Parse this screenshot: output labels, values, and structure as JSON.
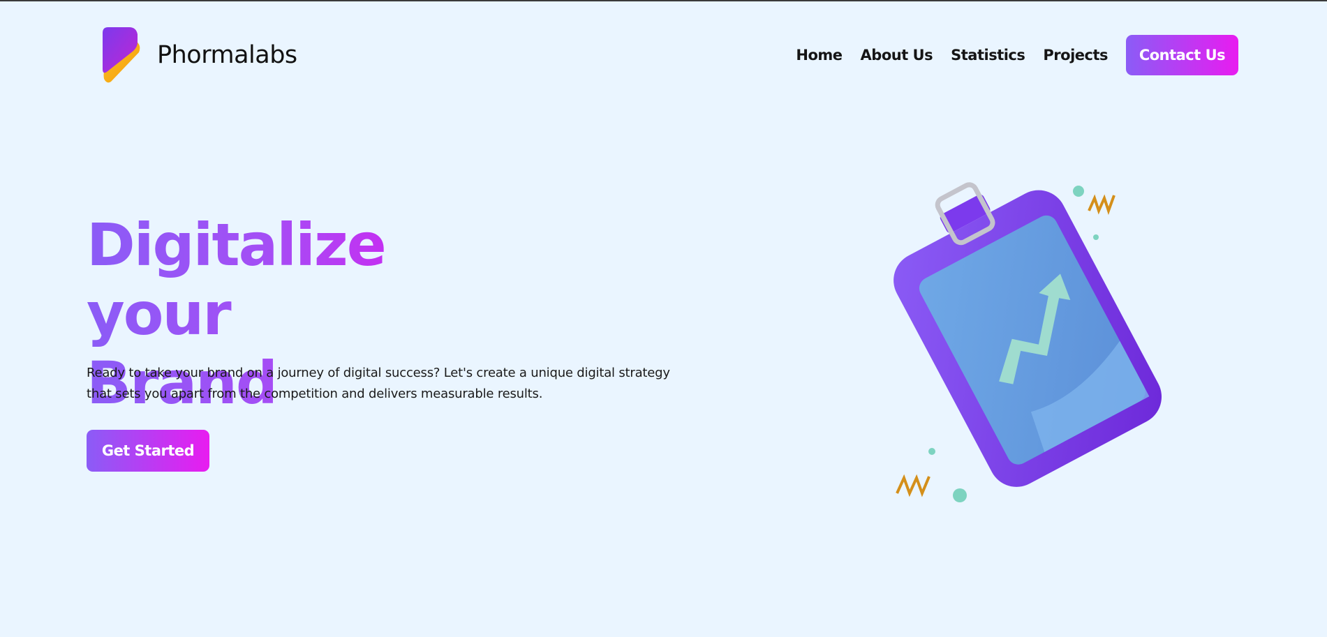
{
  "header": {
    "brand_name": "Phormalabs",
    "logo_icon": "logo-icon",
    "nav": [
      "Home",
      "About Us",
      "Statistics",
      "Projects"
    ],
    "contact_label": "Contact Us"
  },
  "hero": {
    "title_line1": "Digitalize your",
    "title_line2": "Brand",
    "description": "Ready to take your brand on a journey of digital success? Let's create a unique digital strategy that sets you apart from the competition and delivers measurable results.",
    "cta_label": "Get Started",
    "illustration_icon": "clipboard-growth-icon"
  },
  "colors": {
    "background": "#eaf5ff",
    "gradient_start": "#8b5cf6",
    "gradient_end": "#e81cf0",
    "text": "#151515"
  }
}
